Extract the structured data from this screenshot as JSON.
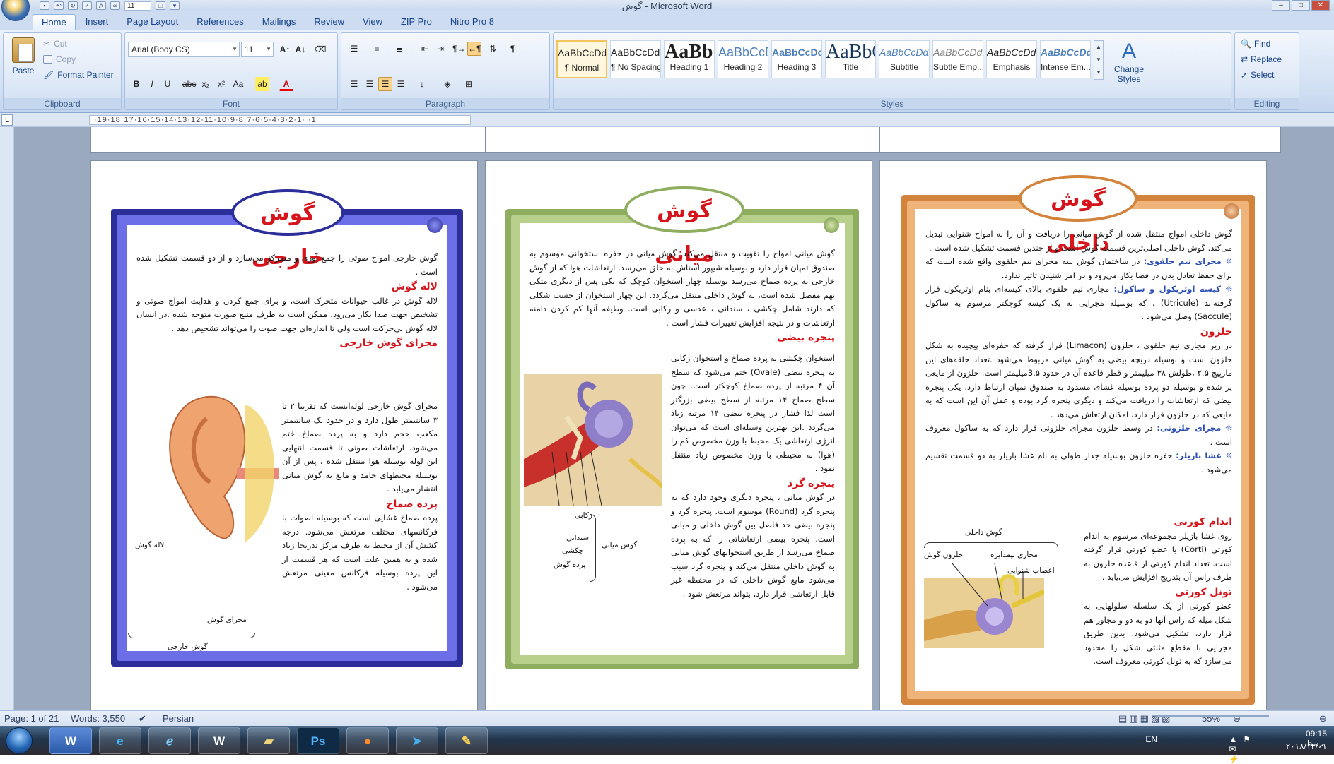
{
  "window": {
    "title": "گوش - Microsoft Word",
    "font_size_qat": "11"
  },
  "tabs": [
    "Home",
    "Insert",
    "Page Layout",
    "References",
    "Mailings",
    "Review",
    "View",
    "ZIP Pro",
    "Nitro Pro 8"
  ],
  "clipboard": {
    "paste": "Paste",
    "cut": "Cut",
    "copy": "Copy",
    "format_painter": "Format Painter",
    "label": "Clipboard"
  },
  "font": {
    "name": "Arial (Body CS)",
    "size": "11",
    "label": "Font"
  },
  "paragraph": {
    "label": "Paragraph"
  },
  "styles": {
    "items": [
      {
        "preview": "AaBbCcDdEe",
        "name": "¶ Normal"
      },
      {
        "preview": "AaBbCcDdEe",
        "name": "¶ No Spacing"
      },
      {
        "preview": "AaBbCcDdEe",
        "name": "Heading 1"
      },
      {
        "preview": "AaBbCcDdEe",
        "name": "Heading 2"
      },
      {
        "preview": "AaBbCcDdEe",
        "name": "Heading 3"
      },
      {
        "preview": "AaBbCcDdEe",
        "name": "Title"
      },
      {
        "preview": "AaBbCcDdEe",
        "name": "Subtitle"
      },
      {
        "preview": "AaBbCcDdEe",
        "name": "Subtle Emp..."
      },
      {
        "preview": "AaBbCcDdEe",
        "name": "Emphasis"
      },
      {
        "preview": "AaBbCcDdEe",
        "name": "Intense Em..."
      }
    ],
    "change_styles": "Change Styles",
    "label": "Styles"
  },
  "editing": {
    "find": "Find",
    "replace": "Replace",
    "select": "Select",
    "label": "Editing"
  },
  "ruler": {
    "numbers": "·19·18·17·16·15·14·13·12·11·10·9·8·7·6·5·4·3·2·1·   ·1"
  },
  "pages": {
    "outer": {
      "title": "گوش خارجی",
      "intro": "گوش خارجی امواج صوتی را جمع آوری و متمرکز می‌سازد و از دو قسمت تشکیل شده است .",
      "h1": "لاله گوش",
      "p1": "لاله گوش در غالب حیوانات متحرک است، و برای جمع کردن و هدایت امواج صوتی و تشخیص جهت صدا بکار می‌رود، ممکن است به طرف منبع صورت متوجه شده .در انسان لاله گوش بی‌حرکت است ولی تا اندازه‌ای جهت صوت را می‌تواند تشخیص دهد .",
      "h2": "مجرای گوش خارجی",
      "p2": "مجرای گوش خارجی لوله‌ایست که تقریبا ۲ تا ۳ سانتیمتر طول دارد و در حدود یک سانتیمتر مکعب حجم دارد و به پرده صماخ ختم می‌شود. ارتعاشات صوتی تا قسمت انتهایی این لوله بوسیله هوا منتقل شده ، پس از آن بوسیله محیطهای جامد و مایع به گوش میانی انتشار می‌یابد .",
      "h3": "پرده صماخ",
      "p3": "پرده صماخ غشایی است که بوسیله اصوات با فرکانسهای مختلف مرتعش می‌شود. درجه کشش آن از محیط به طرف مرکز تدریجا زیاد شده و به همین علت است که هر قسمت از این پرده بوسیله فرکانس معینی مرتعش می‌شود .",
      "cap_pinna": "لاله گوش",
      "cap_canal": "مجرای گوش",
      "cap_outer": "گوش خارجی"
    },
    "middle": {
      "title": "گوش میانی",
      "intro": "گوش میانی امواج را تقویت و منتقل می‌کند. گوش میانی در حفره استخوانی موسوم به صندوق تمپان قرار دارد و بوسیله شیپور استاش به حلق می‌رسد. ارتعاشات هوا که از گوش خارجی به پرده صماخ می‌رسد بوسیله چهار استخوان کوچک که یکی پس از دیگری متکی بهم مفصل شده است، به گوش داخلی منتقل می‌گردد. این چهار استخوان از حسب شکلی که دارند شامل چکشی ، سندانی ، عدسی و رکابی است. وظیفه آنها کم کردن دامنه ارتعاشات و در نتیجه افزایش تغییرات فشار است .",
      "h1": "پنجره بیضی",
      "p1": "استخوان چکشی به پرده صماخ و استخوان رکابی به پنجره بیضی (Ovale) ختم می‌شود که سطح آن ۴ مرتبه از پرده صماخ کوچکتر است. چون سطح صماخ ۱۴ مرتبه از سطح بیضی بزرگتر است لذا فشار در پنجره بیضی ۱۴ مرتبه زیاد می‌گردد .این بهترین وسیله‌ای است که می‌توان انرژی ارتعاشی یک محیط با وزن مخصوص کم را (هوا) به محیطی با وزن مخصوص زیاد منتقل نمود .",
      "h2": "پنجره گرد",
      "p2": "در گوش میانی ، پنجره دیگری وجود دارد که به پنجره گرد (Round) موسوم است. پنجره گرد و پنجره بیضی حد فاصل بین گوش داخلی و میانی است. پنجره بیضی ارتعاشاتی را که به پرده صماخ می‌رسد از طریق استخوانهای گوش میانی به گوش داخلی منتقل می‌کند و پنجره گرد سبب می‌شود مایع گوش داخلی که در محفظه غیر قابل ارتعاشی قرار دارد، بتواند مرتعش شود .",
      "cap_stapes": "رکابی",
      "cap_incus": "سندانی",
      "cap_malleus": "چکشی",
      "cap_drum": "پرده گوش",
      "cap_middle": "گوش میانی"
    },
    "inner": {
      "title": "گوش داخلی",
      "intro": "گوش داخلی امواج منتقل شده از گوش میانی را دریافت و آن را به امواج شنوایی تبدیل می‌کند. گوش داخلی اصلی‌ترین قسمت گوش است و از چندین قسمت تشکیل شده است .",
      "b1": "مجرای نیم حلقوی:",
      "p1": "در ساختمان گوش سه مجرای نیم حلقوی واقع شده است که برای حفظ تعادل بدن در فضا بکار می‌رود و در امر شنیدن تاثیر ندارد.",
      "b2": "کیسه اوتریکول و ساکول:",
      "p2": "مجاری نیم حلقوی بالای کیسه‌ای بنام اوتریکول قرار گرفته‌اند (Utricule) ، که بوسیله مجرایی به یک کیسه کوچکتر مرسوم به ساکول (Saccule) وصل می‌شود .",
      "h1": "حلزون",
      "p3": "در زیر مجاری نیم حلقوی ، حلزون (Limacon) قرار گرفته که حفره‌ای پیچیده به شکل حلزون است و بوسیله دریچه بیضی به گوش میانی مربوط می‌شود .تعداد حلقه‌های این مارپیچ ۲.۵ ،طولش ۳۸ میلیمتر و قطر قاعده آن در حدود 3.۵میلیمتر است. حلزون از مایعی پر شده و بوسیله دو پرده بوسیله غشای مسدود به صندوق تمپان ارتباط دارد. یکی پنجره بیضی که ارتعاشات را دریافت می‌کند و دیگری پنجره گرد بوده و عمل آن این است که به مایعی که در حلزون قرار دارد، امکان ارتعاش می‌دهد .",
      "b3": "مجرای حلزونی:",
      "p4": "در وسط حلزون مجرای حلزونی قرار دارد که به ساکول معروف است .",
      "b4": "غشا بازیلر:",
      "p5": "حفره حلزون بوسیله جدار طولی به نام غشا بازیلر به دو قسمت تقسیم می‌شود .",
      "h2": "اندام کورتی",
      "p6": "روی غشا بازیلر مجموعه‌ای مرسوم به اندام کورتی (Corti) یا عضو کورتی قرار گرفته است. تعداد اندام کورتی از قاعده حلزون به طرف راس آن بتدریج افزایش می‌یابد .",
      "h3": "تونل کورتی",
      "p7": "عضو کورتی از یک سلسله سلولهایی به شکل میله که راس آنها دو به دو و مجاور هم قرار دارد، تشکیل می‌شود. بدین طریق مجرایی با مقطع مثلثی شکل را محدود می‌سازد که به تونل کورتی معروف است.",
      "cap_inner": "گوش داخلی",
      "cap_snail": "حلزون گوش",
      "cap_semi": "مجاری نیمدایره",
      "cap_nerve": "اعصاب شنوایی"
    }
  },
  "status": {
    "page": "Page: 1 of 21",
    "words": "Words: 3,550",
    "language": "Persian",
    "zoom": "55%"
  },
  "taskbar": {
    "apps": [
      "W",
      "e",
      "Ps"
    ],
    "lang": "EN",
    "time": "09:15 ب.ظ",
    "date": "۲۰۱۸/۱۳/۰۱"
  },
  "colors": {
    "outer_frame": "#2c2f9a",
    "middle_frame": "#8fad5e",
    "inner_frame": "#d2843c",
    "title_red": "#d6141b"
  }
}
